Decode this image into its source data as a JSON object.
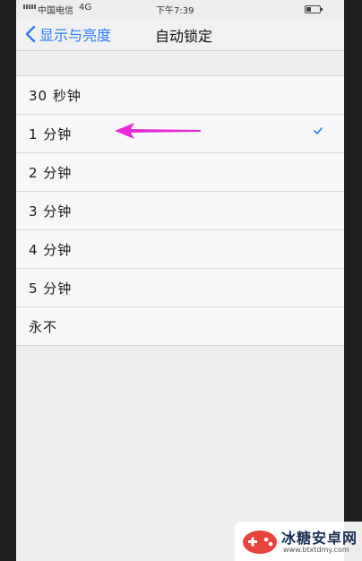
{
  "status_bar": {
    "carrier": "中国电信",
    "network": "4G",
    "time": "下午7:39"
  },
  "nav": {
    "back_label": "显示与亮度",
    "title": "自动锁定"
  },
  "options": [
    {
      "label": "30 秒钟",
      "selected": false
    },
    {
      "label": "1 分钟",
      "selected": true
    },
    {
      "label": "2 分钟",
      "selected": false
    },
    {
      "label": "3 分钟",
      "selected": false
    },
    {
      "label": "4 分钟",
      "selected": false
    },
    {
      "label": "5 分钟",
      "selected": false
    },
    {
      "label": "永不",
      "selected": false
    }
  ],
  "colors": {
    "accent": "#2e7cf6",
    "annotation": "#e62bd8",
    "background": "#ededef"
  },
  "watermark": {
    "text": "冰糖安卓网",
    "url": "www.btxtdmy.com"
  }
}
